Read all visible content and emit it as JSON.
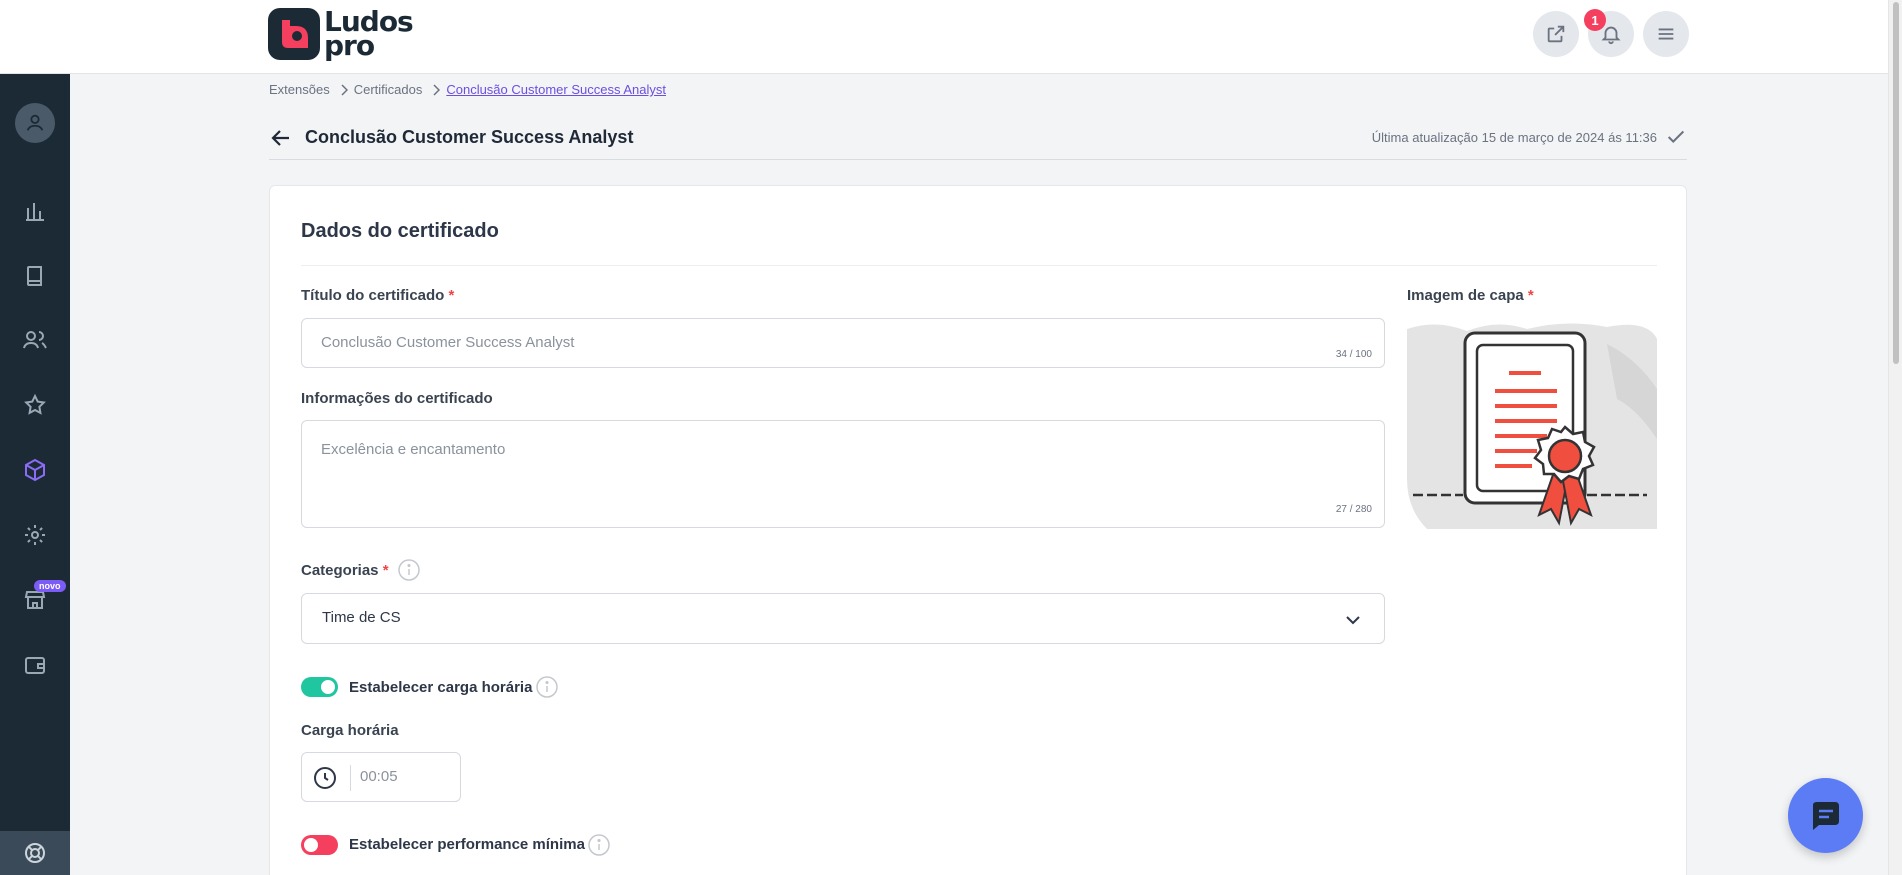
{
  "brand": {
    "line1": "Ludos",
    "line2": "pro"
  },
  "header": {
    "notification_count": "1"
  },
  "sidebar": {
    "new_badge": "novo"
  },
  "breadcrumb": {
    "items": [
      "Extensões",
      "Certificados",
      "Conclusão Customer Success Analyst"
    ]
  },
  "page": {
    "title": "Conclusão Customer Success Analyst",
    "last_updated": "Última atualização 15 de março de 2024 ás 11:36"
  },
  "card": {
    "title": "Dados do certificado",
    "title_field": {
      "label": "Título do certificado",
      "placeholder": "Conclusão Customer Success Analyst",
      "counter": "34 / 100"
    },
    "info_field": {
      "label": "Informações do certificado",
      "placeholder": "Excelência e encantamento",
      "counter": "27 / 280"
    },
    "cover_image": {
      "label": "Imagem de capa"
    },
    "categories": {
      "label": "Categorias",
      "selected": "Time de CS"
    },
    "workload_toggle": {
      "label": "Estabelecer carga horária",
      "on": true
    },
    "workload": {
      "label": "Carga horária",
      "placeholder": "00:05"
    },
    "performance_toggle": {
      "label": "Estabelecer performance mínima",
      "on": false
    }
  },
  "colors": {
    "sidebar": "#1c2a36",
    "accent": "#7c5cf6",
    "toggle_on": "#1fc6a0",
    "toggle_off": "#f43f5e",
    "required": "#ef4444",
    "chat": "#5b7cf5"
  }
}
